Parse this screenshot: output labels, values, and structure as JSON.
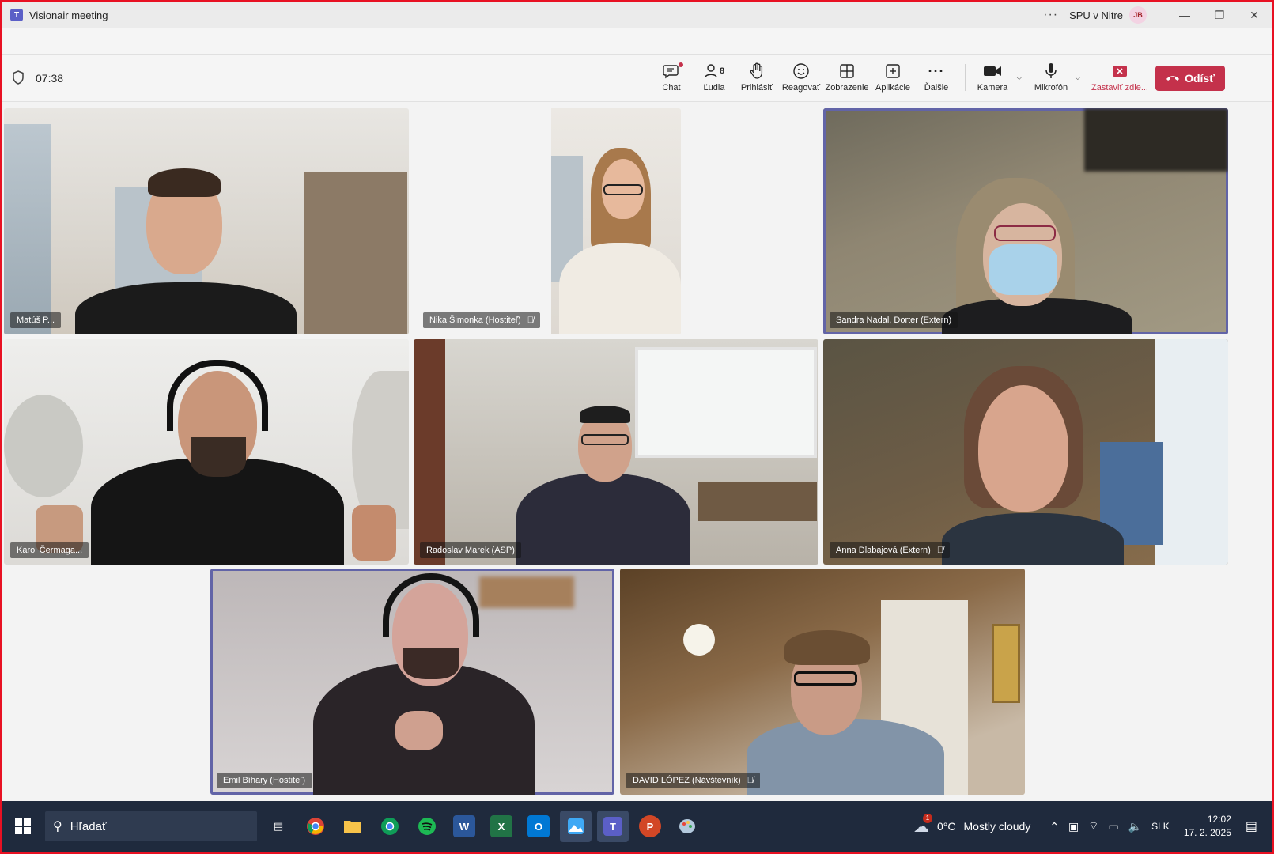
{
  "window": {
    "title": "Visionair meeting",
    "org": "SPU v Nitre",
    "user_initials": "JB"
  },
  "meeting": {
    "timer": "07:38",
    "people_count": "8"
  },
  "toolbar": {
    "chat": "Chat",
    "people": "Ľudia",
    "raise": "Prihlásiť",
    "react": "Reagovať",
    "view": "Zobrazenie",
    "apps": "Aplikácie",
    "more": "Ďalšie",
    "camera": "Kamera",
    "mic": "Mikrofón",
    "stop_share": "Zastaviť zdie...",
    "leave": "Odísť"
  },
  "participants": [
    {
      "name": "Matúš P...",
      "muted": false
    },
    {
      "name": "Nika Šimonka (Hostiteľ)",
      "muted": true
    },
    {
      "name": "Sandra Nadal, Dorter (Extern)",
      "muted": false
    },
    {
      "name": "Karol Čermaga...",
      "muted": false
    },
    {
      "name": "Radoslav Marek (ASP)",
      "muted": false
    },
    {
      "name": "Anna Dlabajová (Extern)",
      "muted": true
    },
    {
      "name": "Emil Bíhary (Hostiteľ)",
      "muted": false
    },
    {
      "name": "DAVID LÓPEZ (Návštevník)",
      "muted": true
    }
  ],
  "taskbar": {
    "search_placeholder": "Hľadať",
    "weather_temp": "0°C",
    "weather_desc": "Mostly cloudy",
    "weather_badge": "1",
    "lang": "SLK",
    "time": "12:02",
    "date": "17. 2. 2025"
  },
  "colors": {
    "accent": "#6264a7",
    "leave": "#c4314b",
    "taskbar": "#1f2a3d"
  }
}
